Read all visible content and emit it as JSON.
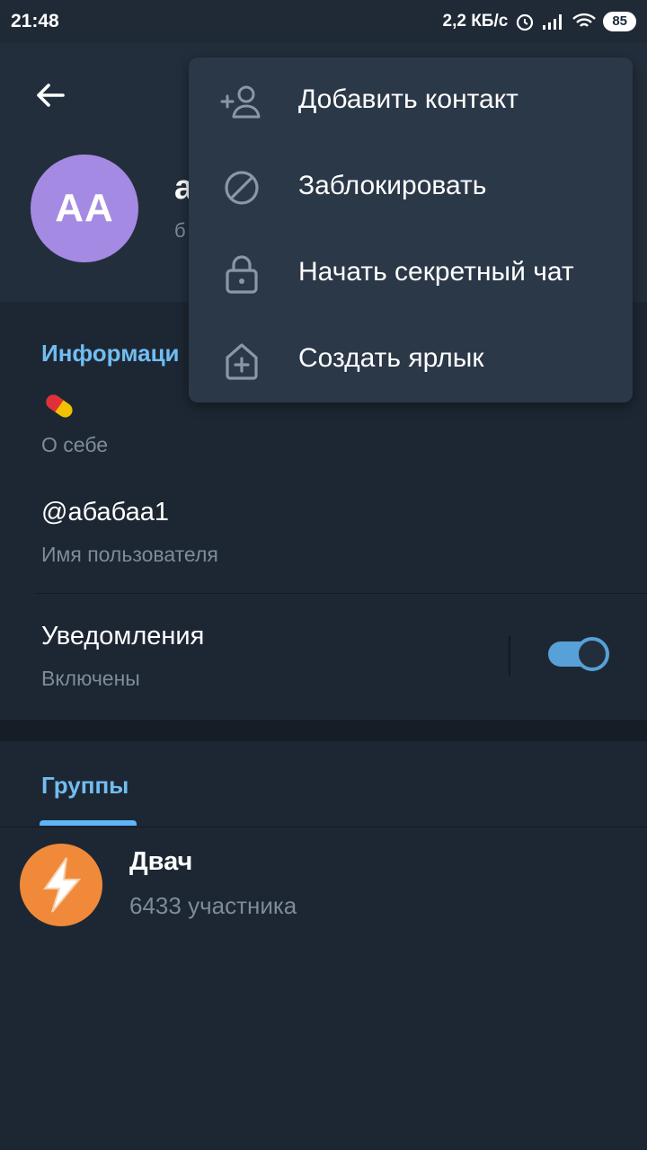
{
  "status_bar": {
    "time": "21:48",
    "network_speed": "2,2 КБ/с",
    "battery": "85"
  },
  "profile": {
    "avatar_initials": "AA",
    "name": "а",
    "last_seen": "б"
  },
  "info": {
    "section_title": "Информаци",
    "bio_emoji": "pill-icon",
    "bio_label": "О себе",
    "username": "@абабаа1",
    "username_label": "Имя пользователя",
    "notifications_label": "Уведомления",
    "notifications_state": "Включены",
    "notifications_on": true
  },
  "groups": {
    "tab_label": "Группы",
    "items": [
      {
        "name": "Двач",
        "members": "6433 участника"
      }
    ]
  },
  "menu": {
    "items": [
      {
        "label": "Добавить контакт",
        "icon": "add-contact-icon"
      },
      {
        "label": "Заблокировать",
        "icon": "block-icon"
      },
      {
        "label": "Начать секретный чат",
        "icon": "lock-icon"
      },
      {
        "label": "Создать ярлык",
        "icon": "add-shortcut-icon"
      }
    ]
  },
  "colors": {
    "accent": "#71bdf2",
    "toggle": "#57a1d8",
    "avatar": "#a58ae4",
    "group_avatar": "#f08a3a"
  }
}
